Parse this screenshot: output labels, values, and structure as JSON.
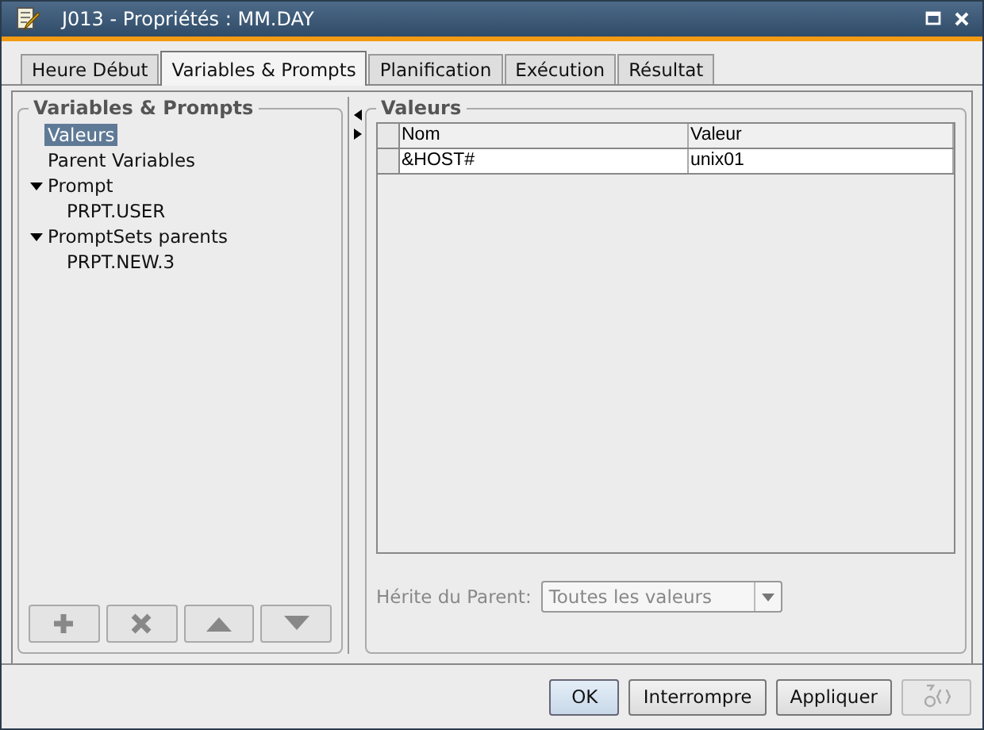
{
  "window": {
    "title": "J013 - Propriétés : MM.DAY"
  },
  "tabs": [
    {
      "label": "Heure Début",
      "selected": false
    },
    {
      "label": "Variables & Prompts",
      "selected": true
    },
    {
      "label": "Planification",
      "selected": false
    },
    {
      "label": "Exécution",
      "selected": false
    },
    {
      "label": "Résultat",
      "selected": false
    }
  ],
  "sidebar": {
    "title": "Variables & Prompts",
    "items": [
      {
        "label": "Valeurs",
        "selected": true
      },
      {
        "label": "Parent Variables",
        "selected": false
      },
      {
        "label": "Prompt",
        "selected": false,
        "expanded": true,
        "children": [
          {
            "label": "PRPT.USER",
            "selected": false
          }
        ]
      },
      {
        "label": "PromptSets parents",
        "selected": false,
        "expanded": true,
        "children": [
          {
            "label": "PRPT.NEW.3",
            "selected": false
          }
        ]
      }
    ]
  },
  "values": {
    "title": "Valeurs",
    "table": {
      "columns": [
        "Nom",
        "Valeur"
      ],
      "rows": [
        [
          "&HOST#",
          "unix01"
        ]
      ]
    },
    "inherit": {
      "label": "Hérite du Parent:",
      "value": "Toutes les valeurs",
      "disabled": true
    }
  },
  "buttons": [
    {
      "label": "OK",
      "selected": true
    },
    {
      "label": "Interrompre",
      "selected": false
    },
    {
      "label": "Appliquer",
      "selected": false
    }
  ]
}
